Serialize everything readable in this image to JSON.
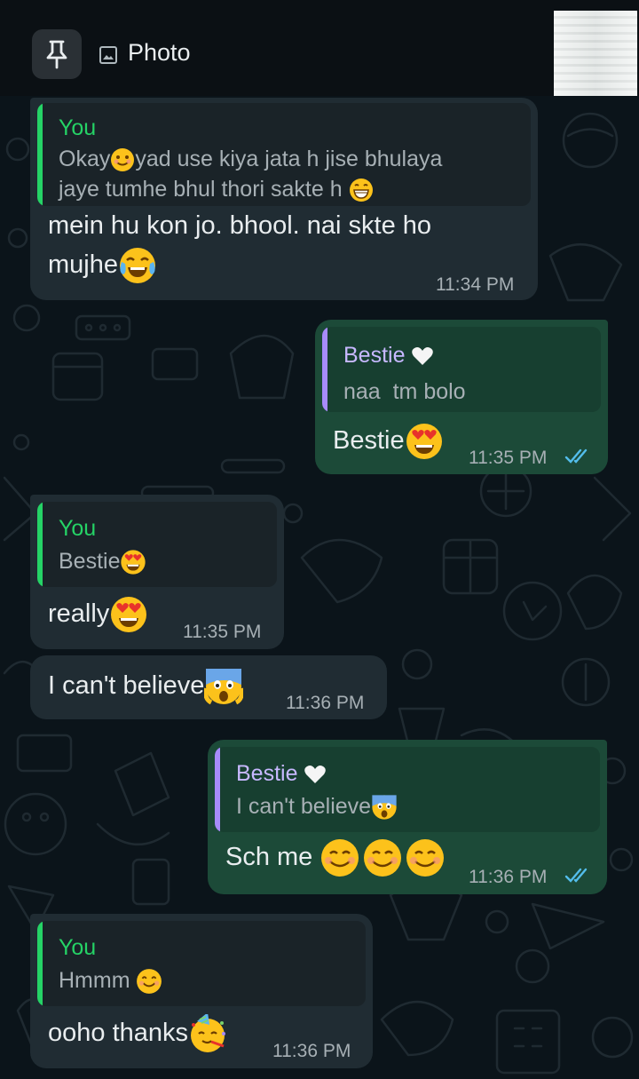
{
  "header": {
    "photo_label": "Photo",
    "pin_icon": "pin-icon",
    "photo_icon": "image-icon"
  },
  "colors": {
    "incoming_bubble": "#202c33",
    "outgoing_bubble": "#1c4a38",
    "you_quote_accent": "#25d366",
    "bestie_quote_accent": "#a78bfa",
    "read_ticks": "#53bdeb"
  },
  "messages": [
    {
      "direction": "incoming",
      "quote_name": "You",
      "quote_text_1": "Okay",
      "quote_text_1b": "yad use kiya jata h jise bhulaya",
      "quote_text_2": "jaye tumhe bhul thori sakte h",
      "text_1": "mein hu kon jo. bhool. nai skte ho",
      "text_2": "mujhe",
      "time": "11:34 PM"
    },
    {
      "direction": "outgoing",
      "quote_name": "Bestie",
      "quote_text": "naa  tm bolo",
      "text": "Bestie",
      "time": "11:35 PM",
      "status": "read"
    },
    {
      "direction": "incoming",
      "quote_name": "You",
      "quote_text": "Bestie",
      "text": "really",
      "time": "11:35 PM"
    },
    {
      "direction": "incoming",
      "text": "I can't believe",
      "time": "11:36 PM"
    },
    {
      "direction": "outgoing",
      "quote_name": "Bestie",
      "quote_text": "I can't believe",
      "text": "Sch me",
      "time": "11:36 PM",
      "status": "read"
    },
    {
      "direction": "incoming",
      "quote_name": "You",
      "quote_text": "Hmmm",
      "text": "ooho thanks",
      "time": "11:36 PM"
    }
  ]
}
